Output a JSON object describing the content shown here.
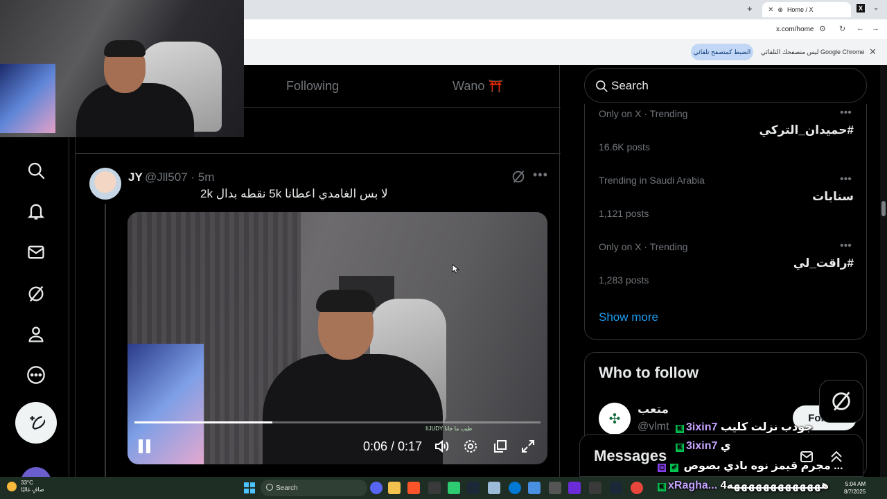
{
  "browser": {
    "tab_title": "Home / X",
    "url": "x.com/home",
    "infobar_text": "Google Chrome ليس متصفحك التلقائي",
    "infobar_button": "الضبط كمتصفح تلقائي"
  },
  "feed": {
    "tab_following": "Following",
    "tab_wano": "Wano ⛩️"
  },
  "tweet": {
    "name": "JY",
    "handle_time": "@Jll507 · 5m",
    "text": "لا بس الغامدي اعطانا 5k نقطه بدال 2k",
    "video": {
      "time": "0:06 / 0:17",
      "progress": 0.34,
      "chat_overlay": "IIJUDY  طيب ما جانا"
    }
  },
  "sidebar": {
    "search_placeholder": "Search",
    "trends": [
      {
        "meta": "Only on X · Trending",
        "name": "#حميدان_التركي",
        "count": "16.6K posts"
      },
      {
        "meta": "Trending in Saudi Arabia",
        "name": "سنابات",
        "count": "1,121 posts"
      },
      {
        "meta": "Only on X · Trending",
        "name": "#راقت_لي",
        "count": "1,283 posts"
      }
    ],
    "show_more": "Show more",
    "who_to_follow": {
      "title": "Who to follow",
      "name": "متعب",
      "handle": "@vlmt",
      "follow_label": "Follow"
    },
    "messages_title": "Messages"
  },
  "stream_chat": [
    {
      "user": "3ixin7",
      "message": "جودب نزلت كليب"
    },
    {
      "user": "3ixin7",
      "message": "ي"
    },
    {
      "user": "",
      "message": "مجرم قيمز نوه بادي بصوص ..."
    },
    {
      "user": "xRagha...",
      "message": "هههههههههههههه4"
    }
  ],
  "taskbar": {
    "weather_temp": "33°C",
    "weather_desc": "صافٍ غالبًا",
    "search_label": "Search",
    "time": "5:04 AM",
    "date": "8/7/2025"
  },
  "colors": {
    "accent": "#1d9bf0",
    "background": "#000000",
    "muted": "#71767b"
  }
}
